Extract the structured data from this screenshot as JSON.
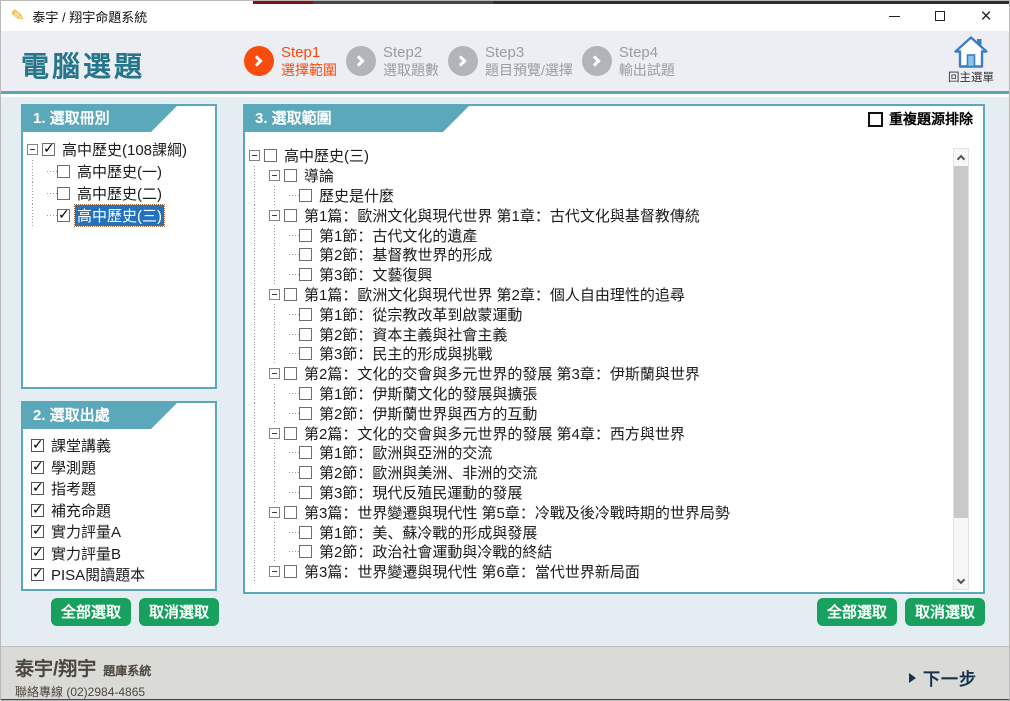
{
  "window": {
    "title": "泰宇 / 翔宇命題系統"
  },
  "header": {
    "page_title": "電腦選題",
    "steps": [
      {
        "label": "Step1",
        "sub": "選擇範圍",
        "active": true
      },
      {
        "label": "Step2",
        "sub": "選取題數",
        "active": false
      },
      {
        "label": "Step3",
        "sub": "題目預覽/選擇",
        "active": false
      },
      {
        "label": "Step4",
        "sub": "輸出試題",
        "active": false
      }
    ],
    "home_label": "回主選單"
  },
  "panel_books": {
    "title": "1. 選取冊別",
    "tree": [
      {
        "label": "高中歷史(108課綱)",
        "level": 0,
        "expander": true,
        "checked": true,
        "selected": false
      },
      {
        "label": "高中歷史(一)",
        "level": 1,
        "expander": false,
        "checked": false,
        "selected": false
      },
      {
        "label": "高中歷史(二)",
        "level": 1,
        "expander": false,
        "checked": false,
        "selected": false
      },
      {
        "label": "高中歷史(三)",
        "level": 1,
        "expander": false,
        "checked": true,
        "selected": true
      }
    ]
  },
  "panel_sources": {
    "title": "2. 選取出處",
    "items": [
      {
        "label": "課堂講義",
        "checked": true
      },
      {
        "label": "學測題",
        "checked": true
      },
      {
        "label": "指考題",
        "checked": true
      },
      {
        "label": "補充命題",
        "checked": true
      },
      {
        "label": "實力評量A",
        "checked": true
      },
      {
        "label": "實力評量B",
        "checked": true
      },
      {
        "label": "PISA閱讀題本",
        "checked": true
      }
    ],
    "select_all": "全部選取",
    "deselect_all": "取消選取"
  },
  "panel_scope": {
    "title": "3. 選取範圍",
    "dedupe_label": "重複題源排除",
    "dedupe_checked": false,
    "tree": [
      {
        "label": "高中歷史(三)",
        "level": 0,
        "expander": true,
        "checked": false
      },
      {
        "label": "導論",
        "level": 1,
        "expander": true,
        "checked": false
      },
      {
        "label": "歷史是什麼",
        "level": 2,
        "expander": false,
        "checked": false
      },
      {
        "label": "第1篇：歐洲文化與現代世界 第1章：古代文化與基督教傳統",
        "level": 1,
        "expander": true,
        "checked": false
      },
      {
        "label": "第1節：古代文化的遺產",
        "level": 2,
        "expander": false,
        "checked": false
      },
      {
        "label": "第2節：基督教世界的形成",
        "level": 2,
        "expander": false,
        "checked": false
      },
      {
        "label": "第3節：文藝復興",
        "level": 2,
        "expander": false,
        "checked": false
      },
      {
        "label": "第1篇：歐洲文化與現代世界 第2章：個人自由理性的追尋",
        "level": 1,
        "expander": true,
        "checked": false
      },
      {
        "label": "第1節：從宗教改革到啟蒙運動",
        "level": 2,
        "expander": false,
        "checked": false
      },
      {
        "label": "第2節：資本主義與社會主義",
        "level": 2,
        "expander": false,
        "checked": false
      },
      {
        "label": "第3節：民主的形成與挑戰",
        "level": 2,
        "expander": false,
        "checked": false
      },
      {
        "label": "第2篇：文化的交會與多元世界的發展 第3章：伊斯蘭與世界",
        "level": 1,
        "expander": true,
        "checked": false
      },
      {
        "label": "第1節：伊斯蘭文化的發展與擴張",
        "level": 2,
        "expander": false,
        "checked": false
      },
      {
        "label": "第2節：伊斯蘭世界與西方的互動",
        "level": 2,
        "expander": false,
        "checked": false
      },
      {
        "label": "第2篇：文化的交會與多元世界的發展 第4章：西方與世界",
        "level": 1,
        "expander": true,
        "checked": false
      },
      {
        "label": "第1節：歐洲與亞洲的交流",
        "level": 2,
        "expander": false,
        "checked": false
      },
      {
        "label": "第2節：歐洲與美洲、非洲的交流",
        "level": 2,
        "expander": false,
        "checked": false
      },
      {
        "label": "第3節：現代反殖民運動的發展",
        "level": 2,
        "expander": false,
        "checked": false
      },
      {
        "label": "第3篇：世界變遷與現代性 第5章：冷戰及後冷戰時期的世界局勢",
        "level": 1,
        "expander": true,
        "checked": false
      },
      {
        "label": "第1節：美、蘇冷戰的形成與發展",
        "level": 2,
        "expander": false,
        "checked": false
      },
      {
        "label": "第2節：政治社會運動與冷戰的終結",
        "level": 2,
        "expander": false,
        "checked": false
      },
      {
        "label": "第3篇：世界變遷與現代性 第6章：當代世界新局面",
        "level": 1,
        "expander": true,
        "checked": false
      }
    ],
    "select_all": "全部選取",
    "deselect_all": "取消選取"
  },
  "footer": {
    "brand": "泰宇/翔宇",
    "brand_sub": "題庫系統",
    "contact": "聯絡專線 (02)2984-4865",
    "next_label": "下一步"
  },
  "icons": {
    "app": "pen-icon",
    "step_arrow": "chevron-right-icon",
    "home": "home-icon",
    "next": "triangle-right-icon"
  },
  "colors": {
    "accent_teal": "#5CA8BB",
    "title_teal": "#26768B",
    "step_active_orange": "#F84C0E",
    "step_inactive_gray": "#B3B3BB",
    "button_green": "#17A05E",
    "selection_blue": "#2372C0",
    "header_bg": "#EDEEF4",
    "content_bg": "#E4EDF2",
    "footer_bg": "#DADAD7",
    "home_blue": "#3B7EC2"
  }
}
